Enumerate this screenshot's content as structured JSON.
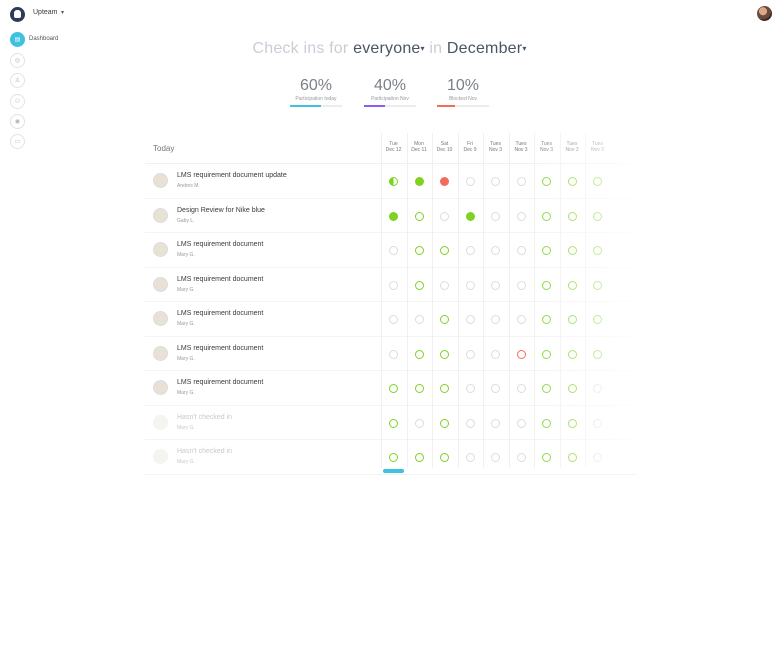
{
  "topbar": {
    "team_name": "Upteam",
    "caret": "▾"
  },
  "sidebar": {
    "items": [
      {
        "icon": "dashboard-icon",
        "glyph": "▤",
        "label": "Dashboard"
      },
      {
        "icon": "checkin-icon",
        "glyph": "◎"
      },
      {
        "icon": "person-icon",
        "glyph": "♙"
      },
      {
        "icon": "team-icon",
        "glyph": "⚇"
      },
      {
        "icon": "settings-icon",
        "glyph": "◉"
      },
      {
        "icon": "billing-icon",
        "glyph": "▭"
      }
    ]
  },
  "headline": {
    "prefix": "Check ins for",
    "audience": "everyone",
    "middle": "in",
    "period": "December",
    "caret": "▾"
  },
  "stats": [
    {
      "value": "60%",
      "label": "Participation today",
      "fraction": 0.6,
      "color": "#3fc1e0"
    },
    {
      "value": "40%",
      "label": "Participation Nov",
      "fraction": 0.4,
      "color": "#8b5cf6"
    },
    {
      "value": "10%",
      "label": "Blocked Nov",
      "fraction": 0.35,
      "color": "#f36c5a"
    }
  ],
  "table": {
    "today_label": "Today",
    "columns": [
      [
        "Tue",
        "Dec 12"
      ],
      [
        "Mon",
        "Dec 11"
      ],
      [
        "Sat",
        "Dec 10"
      ],
      [
        "Fri",
        "Dec 9"
      ],
      [
        "Tues",
        "Nov 3"
      ],
      [
        "Tues",
        "Nov 3"
      ],
      [
        "Tues",
        "Nov 3"
      ],
      [
        "Tues",
        "Nov 3"
      ],
      [
        "Tues",
        "Nov 3"
      ]
    ],
    "rows": [
      {
        "title": "LMS requirement document update",
        "who": "Andres M.",
        "dim": false,
        "cells": [
          "half",
          "fill",
          "red",
          "empty",
          "empty",
          "empty",
          "ring",
          "ring",
          "ring"
        ]
      },
      {
        "title": "Design Review for Nike blue",
        "who": "Gaby L.",
        "dim": false,
        "cells": [
          "fill",
          "ring",
          "empty",
          "fill",
          "empty",
          "empty",
          "ring",
          "ring",
          "ring"
        ]
      },
      {
        "title": "LMS requirement document",
        "who": "Mary G.",
        "dim": false,
        "cells": [
          "empty",
          "ring",
          "ring",
          "empty",
          "empty",
          "empty",
          "ring",
          "ring",
          "ring"
        ]
      },
      {
        "title": "LMS requirement document",
        "who": "Mary G.",
        "dim": false,
        "cells": [
          "empty",
          "ring",
          "empty",
          "empty",
          "empty",
          "empty",
          "ring",
          "ring",
          "ring"
        ]
      },
      {
        "title": "LMS requirement document",
        "who": "Mary G.",
        "dim": false,
        "cells": [
          "empty",
          "empty",
          "ring",
          "empty",
          "empty",
          "empty",
          "ring",
          "ring",
          "ring"
        ]
      },
      {
        "title": "LMS requirement document",
        "who": "Mary G.",
        "dim": false,
        "cells": [
          "empty",
          "ring",
          "ring",
          "empty",
          "empty",
          "redring",
          "ring",
          "ring",
          "ring"
        ]
      },
      {
        "title": "LMS requirement document",
        "who": "Mary G.",
        "dim": false,
        "cells": [
          "ring",
          "ring",
          "ring",
          "empty",
          "empty",
          "empty",
          "ring",
          "ring",
          "empty"
        ]
      },
      {
        "title": "Hasn't checked in",
        "who": "Mary G.",
        "dim": true,
        "cells": [
          "ring",
          "empty",
          "ring",
          "empty",
          "empty",
          "empty",
          "ring",
          "ring",
          "empty"
        ]
      },
      {
        "title": "Hasn't checked in",
        "who": "Mary G.",
        "dim": true,
        "cells": [
          "ring",
          "ring",
          "ring",
          "empty",
          "empty",
          "empty",
          "ring",
          "ring",
          "empty"
        ]
      }
    ]
  }
}
